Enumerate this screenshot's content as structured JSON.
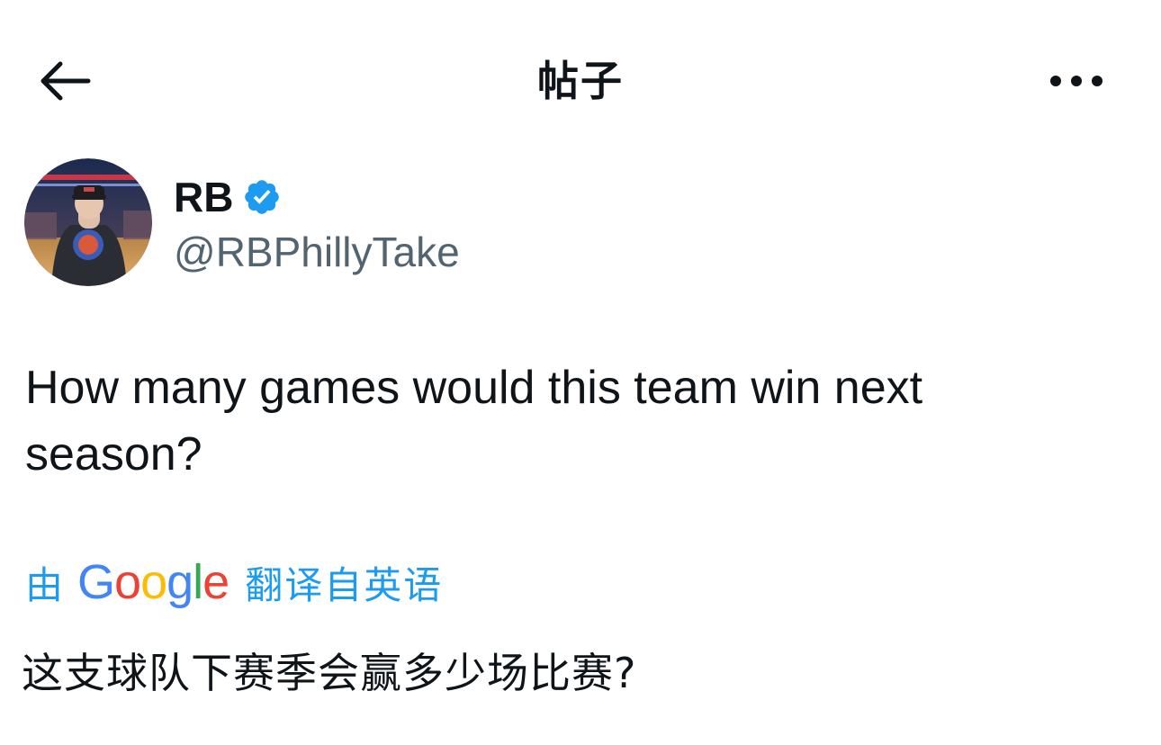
{
  "header": {
    "title": "帖子",
    "back_icon": "arrow-left-icon",
    "more_icon": "more-horizontal-icon"
  },
  "author": {
    "display_name": "RB",
    "handle": "@RBPhillyTake",
    "verified": true,
    "badge_color": "#1d9bf0"
  },
  "tweet": {
    "text": "How many games would this team win next season?"
  },
  "translation": {
    "by_label": "由",
    "provider": {
      "letters": [
        "G",
        "o",
        "o",
        "g",
        "l",
        "e"
      ],
      "colors": [
        "#4285F4",
        "#EA4335",
        "#FBBC05",
        "#4285F4",
        "#34A853",
        "#EA4335"
      ]
    },
    "source_label": "翻译自英语",
    "text": "这支球队下赛季会赢多少场比赛?"
  },
  "colors": {
    "text_primary": "#0f1419",
    "text_secondary": "#536471",
    "accent": "#1d9bf0"
  }
}
